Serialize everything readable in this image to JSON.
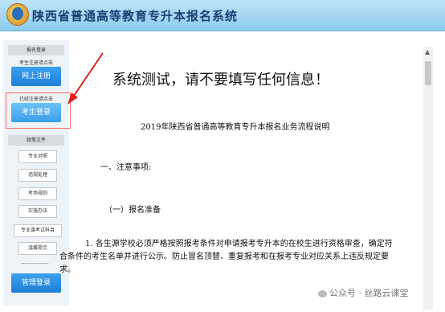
{
  "header": {
    "title": "陕西省普通高等教育专升本报名系统"
  },
  "sidebar": {
    "section1_title": "报名登录",
    "register_note": "考生注册请点击",
    "register_button": "网上注册",
    "login_note": "已经注册请点击",
    "login_button": "考生登录",
    "section2_title": "政策文件",
    "policy_links": [
      "专业对照",
      "违规处理",
      "考场规则",
      "实施办法",
      "专业课考试科目",
      "温馨提示"
    ],
    "separator": "----------------",
    "admin_button": "管理登录"
  },
  "content": {
    "headline": "系统测试，请不要填写任何信息！",
    "doc_title": "2019年陕西省普通高等教育专升本报名业务流程说明",
    "section1": "一、注意事项:",
    "subsection1": "（一）报名准备",
    "para1": "1. 各生源学校必须严格按照报考条件对申请报考专升本的在校生进行资格审查，确定符合条件的考生名单并进行公示。防止冒名顶替、重复报考和在报考专业对应关系上违反规定要求。"
  },
  "watermark": "公众号 · 丝路云课堂",
  "colors": {
    "highlight": "#ff6a6a",
    "button": "#2b8fe6",
    "arrow": "#e02020"
  }
}
